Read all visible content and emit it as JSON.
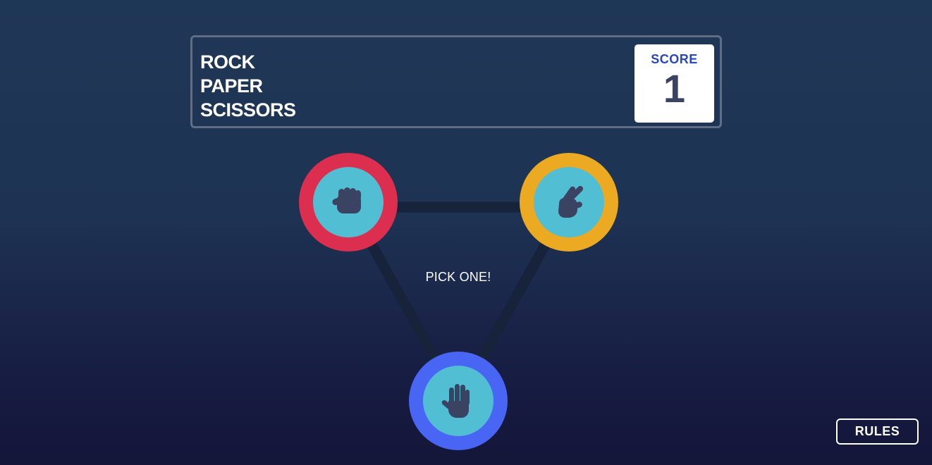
{
  "header": {
    "title_lines": [
      "ROCK",
      "PAPER",
      "SCISSORS"
    ],
    "score_label": "SCORE",
    "score_value": "1"
  },
  "game": {
    "instruction": "PICK ONE!",
    "choices": [
      {
        "id": "rock",
        "icon": "fist-icon",
        "ring_color": "#dc2e4e"
      },
      {
        "id": "scissors",
        "icon": "scissors-hand-icon",
        "ring_color": "#eca922"
      },
      {
        "id": "paper",
        "icon": "open-hand-icon",
        "ring_color": "#4865f4"
      }
    ],
    "inner_color": "#52bed3",
    "icon_color": "#3b4363",
    "line_color": "#17223b"
  },
  "footer": {
    "rules_label": "RULES"
  }
}
